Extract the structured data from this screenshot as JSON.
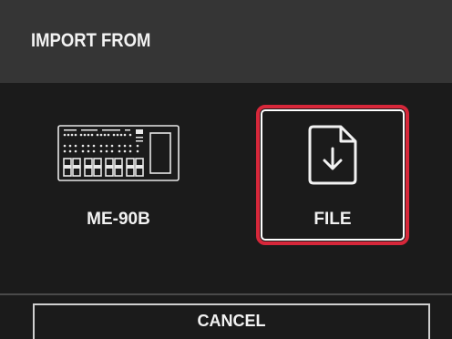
{
  "dialog": {
    "title": "IMPORT FROM"
  },
  "options": [
    {
      "label": "ME-90B",
      "icon": "multi-effects-pedal-icon",
      "selected": false
    },
    {
      "label": "FILE",
      "icon": "file-download-icon",
      "selected": true
    }
  ],
  "footer": {
    "cancel_label": "CANCEL"
  },
  "colors": {
    "header_bg": "#353535",
    "body_bg": "#1b1b1b",
    "selection_border": "#d7273a",
    "text": "#f2f2f2"
  }
}
